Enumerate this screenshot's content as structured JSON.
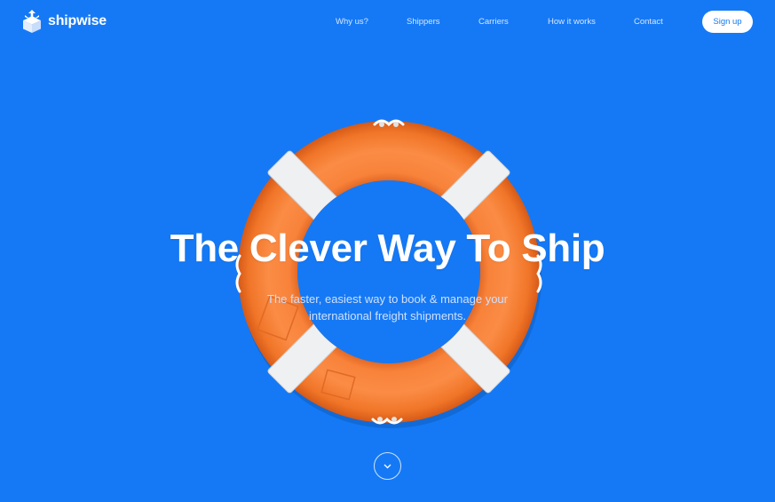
{
  "brand": {
    "name": "shipwise"
  },
  "nav": {
    "items": [
      {
        "label": "Why us?"
      },
      {
        "label": "Shippers"
      },
      {
        "label": "Carriers"
      },
      {
        "label": "How it works"
      },
      {
        "label": "Contact"
      }
    ],
    "signup_label": "Sign up"
  },
  "hero": {
    "title": "The Clever Way To Ship",
    "subtitle_line1": "The faster, easiest way to book & manage your",
    "subtitle_line2": "international freight shipments.",
    "image": "lifebuoy-ring"
  },
  "scroll_down": {
    "icon": "chevron-down-icon"
  },
  "colors": {
    "background": "#1579f5",
    "ring": "#f47a2e",
    "button_text": "#1579f5"
  }
}
